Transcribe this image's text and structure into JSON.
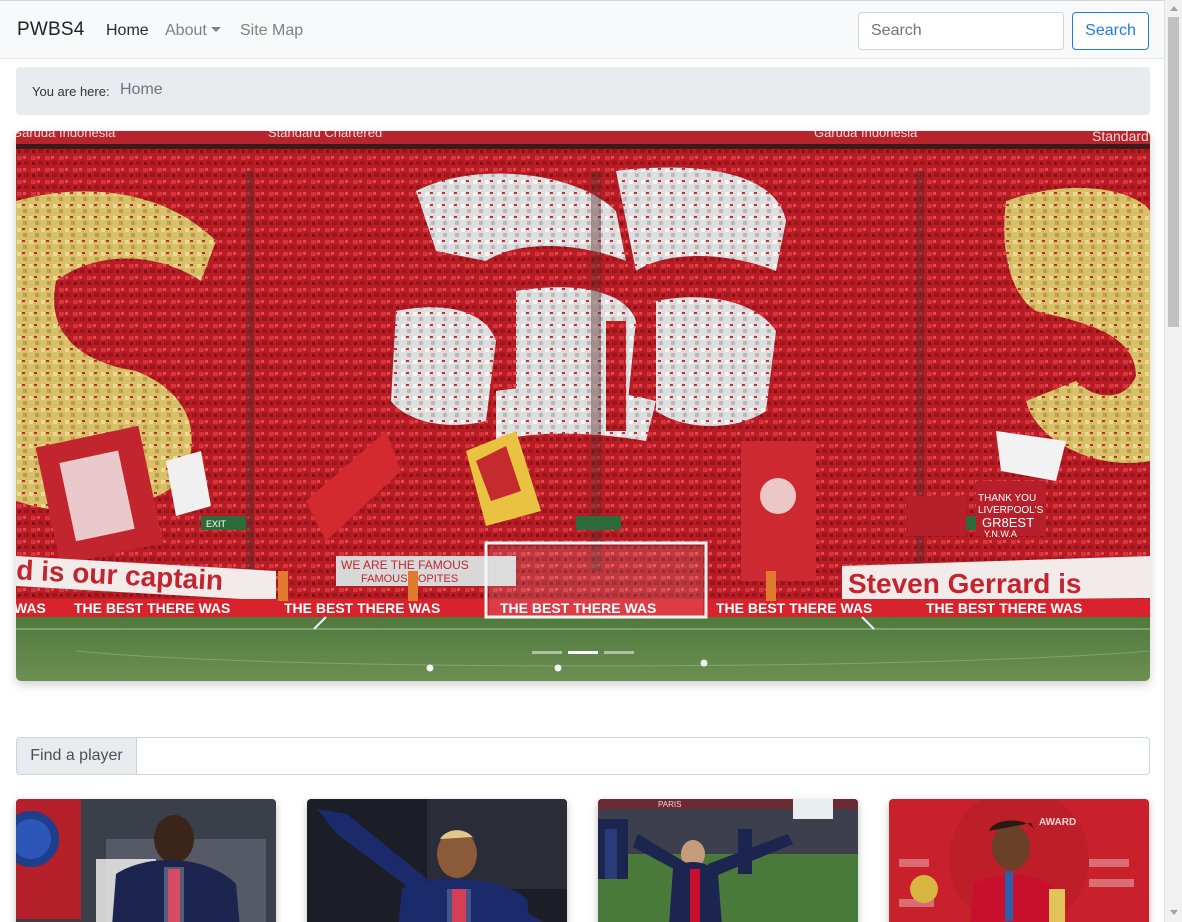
{
  "navbar": {
    "brand": "PWBS4",
    "links": [
      {
        "label": "Home",
        "active": true
      },
      {
        "label": "About",
        "has_dropdown": true
      },
      {
        "label": "Site Map"
      }
    ],
    "search": {
      "placeholder": "Search",
      "button_label": "Search"
    }
  },
  "breadcrumb": {
    "label": "You are here:",
    "items": [
      "Home"
    ]
  },
  "carousel": {
    "slide_count": 3,
    "active_index": 1,
    "image_text": {
      "sponsor_left": "Garuda Indonesia",
      "sponsor_center": "Standard Chartered",
      "sponsor_right": "Garuda Indonesia",
      "sponsor_far_right": "Standard",
      "banner_left": "d is our captain",
      "banner_mid": "WE ARE THE FAMOUS",
      "banner_mid_2": "FAMOUS KOPITES",
      "banner_right": "Steven Gerrard is",
      "banner_thanks_1": "THANK YOU",
      "banner_thanks_2": "LIVERPOOL'S",
      "banner_thanks_3": "GR8EST",
      "banner_thanks_4": "Y.N.W.A",
      "ad_board": "THE BEST THERE WAS",
      "exit_sign": "EXIT"
    }
  },
  "find_player": {
    "label": "Find a player",
    "value": ""
  },
  "player_cards": [
    {
      "name": "player-card-1",
      "image_text": "",
      "colors": {
        "bg": "#3a3f4a",
        "kit": "#1b2550"
      }
    },
    {
      "name": "player-card-2",
      "image_text": "",
      "colors": {
        "bg": "#1c1e27",
        "kit": "#1a2a6b"
      }
    },
    {
      "name": "player-card-3",
      "image_text": "PARIS",
      "colors": {
        "bg": "#34543a",
        "kit": "#1b2550"
      }
    },
    {
      "name": "player-card-4",
      "image_text": "AWARD",
      "colors": {
        "bg": "#c8212c",
        "kit": "#c8102e"
      }
    }
  ],
  "colors": {
    "primary": "#1d7af3",
    "navbar_bg": "#f8f9fa",
    "breadcrumb_bg": "#e9ecef",
    "stand_red": "#c8232a",
    "ad_board_red": "#d8222c"
  }
}
